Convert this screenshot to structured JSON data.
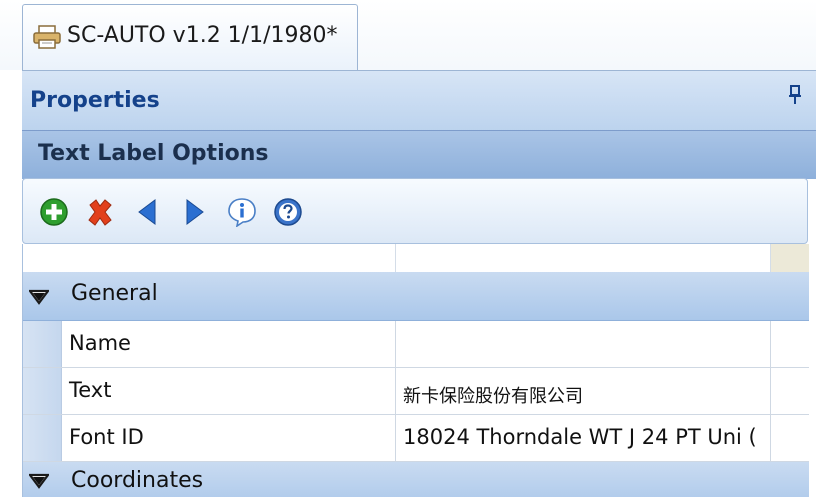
{
  "document_tab": {
    "title": "SC-AUTO v1.2 1/1/1980*",
    "icon": "printer-icon"
  },
  "properties_panel": {
    "title": "Properties",
    "pin_icon": "pin-icon"
  },
  "section": {
    "title": "Text Label Options"
  },
  "toolbar": {
    "buttons": [
      {
        "icon": "add-icon"
      },
      {
        "icon": "delete-icon"
      },
      {
        "icon": "previous-icon"
      },
      {
        "icon": "next-icon"
      },
      {
        "icon": "info-icon"
      },
      {
        "icon": "help-icon"
      }
    ]
  },
  "grid": {
    "categories": [
      {
        "label": "General",
        "properties": [
          {
            "name": "Name",
            "value": ""
          },
          {
            "name": "Text",
            "value": "新卡保险股份有限公司"
          },
          {
            "name": "Font ID",
            "value": "18024 Thorndale WT J 24 PT Uni ("
          }
        ]
      },
      {
        "label": "Coordinates"
      }
    ]
  },
  "colors": {
    "header_text": "#15428b",
    "section_bar": "#a9c4e6",
    "category_row": "#aac7ea",
    "add_green": "#2e9e2e",
    "delete_red": "#e2401c",
    "nav_blue": "#2b6fd1"
  }
}
